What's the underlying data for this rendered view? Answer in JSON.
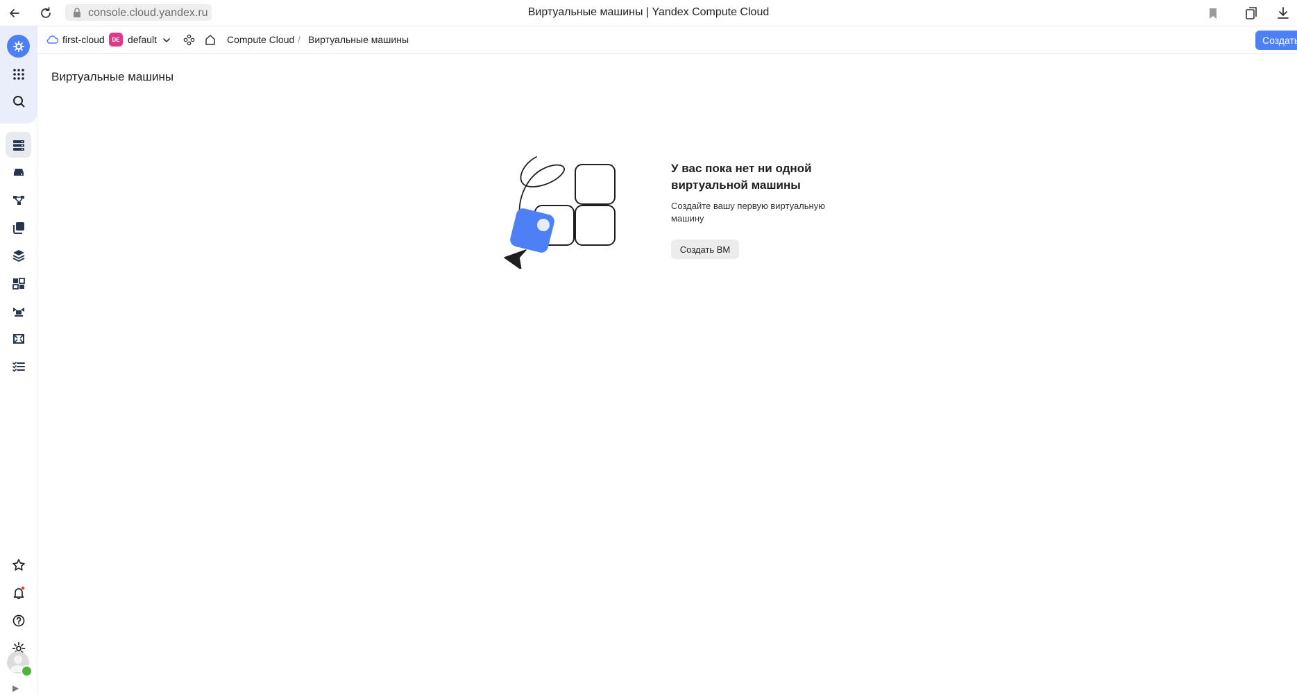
{
  "browser": {
    "url": "console.cloud.yandex.ru",
    "window_title": "Виртуальные машины | Yandex Compute Cloud"
  },
  "header": {
    "cloud_name": "first-cloud",
    "folder_badge": "DE",
    "folder_name": "default",
    "breadcrumb_service": "Compute Cloud",
    "breadcrumb_separator": "/",
    "breadcrumb_current": "Виртуальные машины",
    "create_button": "Создать ВМ"
  },
  "page": {
    "title": "Виртуальные машины"
  },
  "empty_state": {
    "title": "У вас пока нет ни одной виртуальной машины",
    "subtitle": "Создайте вашу первую виртуальную машину",
    "button": "Создать ВМ"
  },
  "colors": {
    "accent": "#4d7ff5",
    "folder_badge": "#e0388b",
    "rail_top": "#e9eefa"
  },
  "icons": {
    "rail_top": [
      "brand-icon",
      "apps-grid-icon",
      "search-icon"
    ],
    "rail_services": [
      "virtual-machines-icon",
      "disks-icon",
      "placement-groups-icon",
      "snapshots-icon",
      "images-icon",
      "instance-groups-icon",
      "gpu-clusters-icon",
      "file-storage-icon",
      "operations-icon"
    ],
    "rail_bottom": [
      "favorites-star-icon",
      "notifications-bell-icon",
      "help-icon",
      "settings-gear-icon"
    ]
  }
}
